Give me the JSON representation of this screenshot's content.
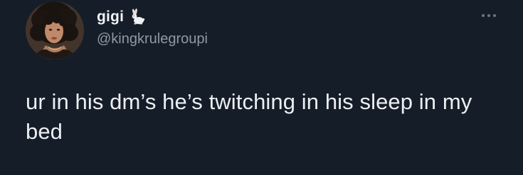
{
  "tweet": {
    "author": {
      "display_name": "gigi",
      "name_emoji": "rabbit-icon",
      "handle": "@kingkrulegroupi",
      "avatar": "profile-photo"
    },
    "menu_icon": "more-horizontal-icon",
    "text": "ur in his dm’s he’s twitching in his sleep in my bed"
  },
  "colors": {
    "background": "#151d29",
    "text_primary": "#eceff1",
    "text_secondary": "#8f9aa5"
  }
}
